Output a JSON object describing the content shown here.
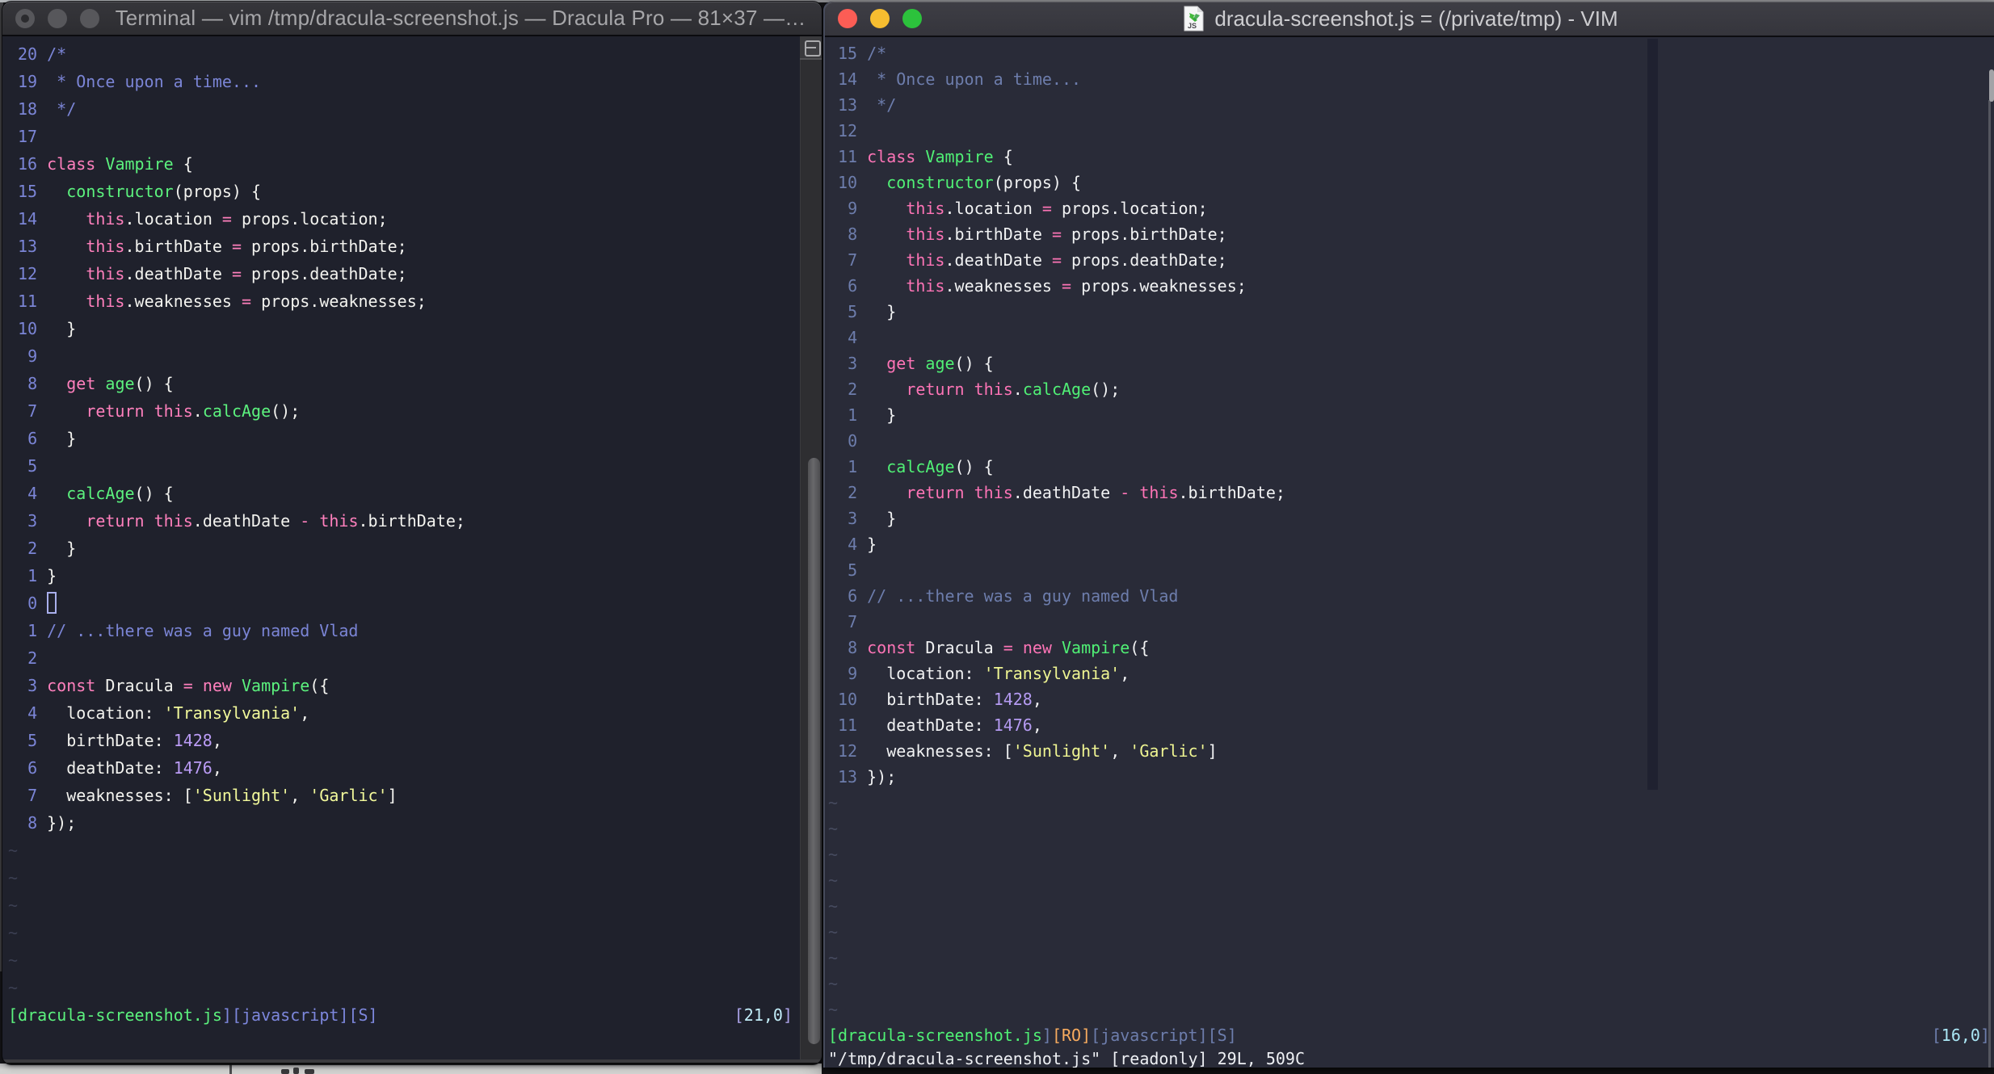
{
  "palette": {
    "left_background": "#1f212c",
    "right_background": "#292b38",
    "foreground": "#f3f3ef",
    "comment_left": "#7b85d6",
    "comment_right": "#6d7dac",
    "pink": "#ff80bd",
    "green": "#5cf27e",
    "yellow": "#f2f99b",
    "purple_number": "#bb9cf6",
    "orange": "#f7ab5f",
    "cyan": "#c2edf8",
    "traffic_red": "#fc5d55",
    "traffic_yellow": "#f6bd30",
    "traffic_green": "#2cc23c"
  },
  "code_lines": [
    [
      [
        "c",
        "/*"
      ]
    ],
    [
      [
        "c",
        " * Once upon a time..."
      ]
    ],
    [
      [
        "c",
        " */"
      ]
    ],
    [],
    [
      [
        "p",
        "class"
      ],
      [
        "w",
        " "
      ],
      [
        "g",
        "Vampire"
      ],
      [
        "w",
        " {"
      ]
    ],
    [
      [
        "w",
        "  "
      ],
      [
        "g",
        "constructor"
      ],
      [
        "w",
        "(props) {"
      ]
    ],
    [
      [
        "w",
        "    "
      ],
      [
        "p",
        "this"
      ],
      [
        "w",
        ".location "
      ],
      [
        "p",
        "="
      ],
      [
        "w",
        " props.location;"
      ]
    ],
    [
      [
        "w",
        "    "
      ],
      [
        "p",
        "this"
      ],
      [
        "w",
        ".birthDate "
      ],
      [
        "p",
        "="
      ],
      [
        "w",
        " props.birthDate;"
      ]
    ],
    [
      [
        "w",
        "    "
      ],
      [
        "p",
        "this"
      ],
      [
        "w",
        ".deathDate "
      ],
      [
        "p",
        "="
      ],
      [
        "w",
        " props.deathDate;"
      ]
    ],
    [
      [
        "w",
        "    "
      ],
      [
        "p",
        "this"
      ],
      [
        "w",
        ".weaknesses "
      ],
      [
        "p",
        "="
      ],
      [
        "w",
        " props.weaknesses;"
      ]
    ],
    [
      [
        "w",
        "  }"
      ]
    ],
    [],
    [
      [
        "w",
        "  "
      ],
      [
        "p",
        "get"
      ],
      [
        "w",
        " "
      ],
      [
        "g",
        "age"
      ],
      [
        "w",
        "() {"
      ]
    ],
    [
      [
        "w",
        "    "
      ],
      [
        "p",
        "return"
      ],
      [
        "w",
        " "
      ],
      [
        "p",
        "this"
      ],
      [
        "w",
        "."
      ],
      [
        "g",
        "calcAge"
      ],
      [
        "w",
        "();"
      ]
    ],
    [
      [
        "w",
        "  }"
      ]
    ],
    [],
    [
      [
        "w",
        "  "
      ],
      [
        "g",
        "calcAge"
      ],
      [
        "w",
        "() {"
      ]
    ],
    [
      [
        "w",
        "    "
      ],
      [
        "p",
        "return"
      ],
      [
        "w",
        " "
      ],
      [
        "p",
        "this"
      ],
      [
        "w",
        ".deathDate "
      ],
      [
        "p",
        "-"
      ],
      [
        "w",
        " "
      ],
      [
        "p",
        "this"
      ],
      [
        "w",
        ".birthDate;"
      ]
    ],
    [
      [
        "w",
        "  }"
      ]
    ],
    [
      [
        "w",
        "}"
      ]
    ],
    [],
    [
      [
        "c",
        "// ...there was a guy named Vlad"
      ]
    ],
    [],
    [
      [
        "p",
        "const"
      ],
      [
        "w",
        " Dracula "
      ],
      [
        "p",
        "="
      ],
      [
        "w",
        " "
      ],
      [
        "p",
        "new"
      ],
      [
        "w",
        " "
      ],
      [
        "g",
        "Vampire"
      ],
      [
        "w",
        "({"
      ]
    ],
    [
      [
        "w",
        "  location: "
      ],
      [
        "y",
        "'Transylvania'"
      ],
      [
        "w",
        ","
      ]
    ],
    [
      [
        "w",
        "  birthDate: "
      ],
      [
        "n",
        "1428"
      ],
      [
        "w",
        ","
      ]
    ],
    [
      [
        "w",
        "  deathDate: "
      ],
      [
        "n",
        "1476"
      ],
      [
        "w",
        ","
      ]
    ],
    [
      [
        "w",
        "  weaknesses: ["
      ],
      [
        "y",
        "'Sunlight'"
      ],
      [
        "w",
        ", "
      ],
      [
        "y",
        "'Garlic'"
      ],
      [
        "w",
        "]"
      ]
    ],
    [
      [
        "w",
        "});"
      ]
    ]
  ],
  "left_window": {
    "app": "Terminal",
    "title": "Terminal — vim /tmp/dracula-screenshot.js — Dracula Pro — 81×37 —…",
    "line_numbers": [
      "20",
      "19",
      "18",
      "17",
      "16",
      "15",
      "14",
      "13",
      "12",
      "11",
      "10",
      "9",
      "8",
      "7",
      "6",
      "5",
      "4",
      "3",
      "2",
      "1",
      "0",
      "1",
      "2",
      "3",
      "4",
      "5",
      "6",
      "7",
      "8"
    ],
    "tilde_rows": 6,
    "tilde_char": "~",
    "cursor_line": 21,
    "cursor_style": "hollow",
    "status_left": [
      [
        "g",
        "[dracula-screenshot.js"
      ],
      [
        "vb",
        "][javascript][S]"
      ]
    ],
    "status_right": [
      [
        "rb",
        "["
      ],
      [
        "cy",
        "21,0"
      ],
      [
        "rb",
        "]"
      ]
    ]
  },
  "right_window": {
    "app": "VIM",
    "title": "dracula-screenshot.js = (/private/tmp) - VIM",
    "line_numbers": [
      "15",
      "14",
      "13",
      "12",
      "11",
      "10",
      "9",
      "8",
      "7",
      "6",
      "5",
      "4",
      "3",
      "2",
      "1",
      "0",
      "1",
      "2",
      "3",
      "4",
      "5",
      "6",
      "7",
      "8",
      "9",
      "10",
      "11",
      "12",
      "13"
    ],
    "tilde_rows": 9,
    "tilde_char": "~",
    "cursor_line": 16,
    "cursor_style": "none",
    "status_left": [
      [
        "g",
        "[dracula-screenshot.js"
      ],
      [
        "vb",
        "]"
      ],
      [
        "o",
        "[RO]"
      ],
      [
        "vb",
        "[javascript][S]"
      ]
    ],
    "status_right": [
      [
        "rb",
        "["
      ],
      [
        "cy",
        "16,0"
      ],
      [
        "rb",
        "]"
      ]
    ],
    "message": "\"/tmp/dracula-screenshot.js\" [readonly] 29L, 509C"
  }
}
